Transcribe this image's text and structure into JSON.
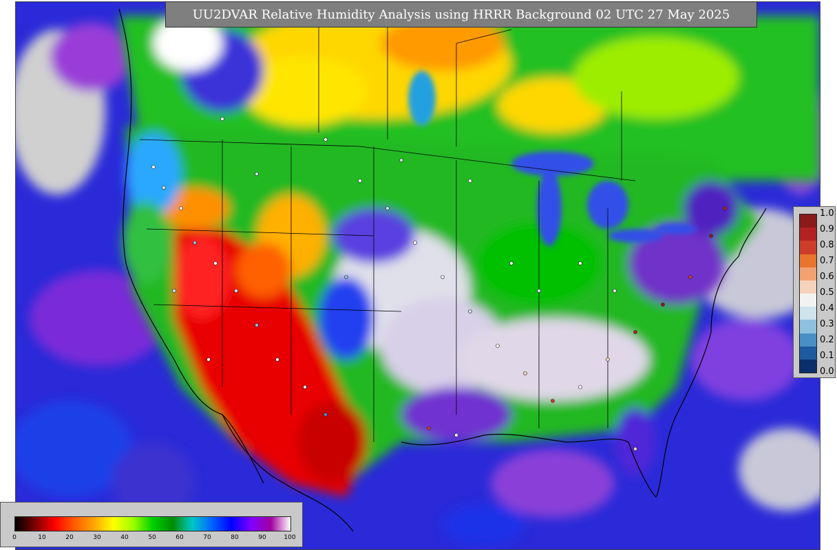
{
  "title": "UU2DVAR Relative Humidity Analysis using HRRR Background 02 UTC 27 May 2025",
  "colorbar_rh": {
    "ticks": [
      "0",
      "10",
      "20",
      "30",
      "40",
      "50",
      "60",
      "70",
      "80",
      "90",
      "100"
    ],
    "stops": [
      "#000000",
      "#7a0000",
      "#ff0000",
      "#ff5a00",
      "#ffa500",
      "#ffff00",
      "#9dff00",
      "#00d000",
      "#008c00",
      "#00c8c8",
      "#0064ff",
      "#0000ff",
      "#8000ff",
      "#a000a0",
      "#ffffff"
    ]
  },
  "colorbar_ratio": {
    "labels": [
      "1.0",
      "0.9",
      "0.8",
      "0.7",
      "0.6",
      "0.5",
      "0.4",
      "0.3",
      "0.2",
      "0.1",
      "0.0"
    ],
    "colors": [
      "#8b1a1a",
      "#b22222",
      "#cd3d2a",
      "#e8742e",
      "#f2a272",
      "#f7d2bd",
      "#f2f2f2",
      "#cde3ee",
      "#8fc1de",
      "#4a8fc3",
      "#1e5aa0",
      "#0b2f6a"
    ]
  },
  "colors": {
    "title_bg": "#7f7f7f",
    "legend_bg": "#c9c9c9",
    "ocean": "#2a2ad8"
  }
}
